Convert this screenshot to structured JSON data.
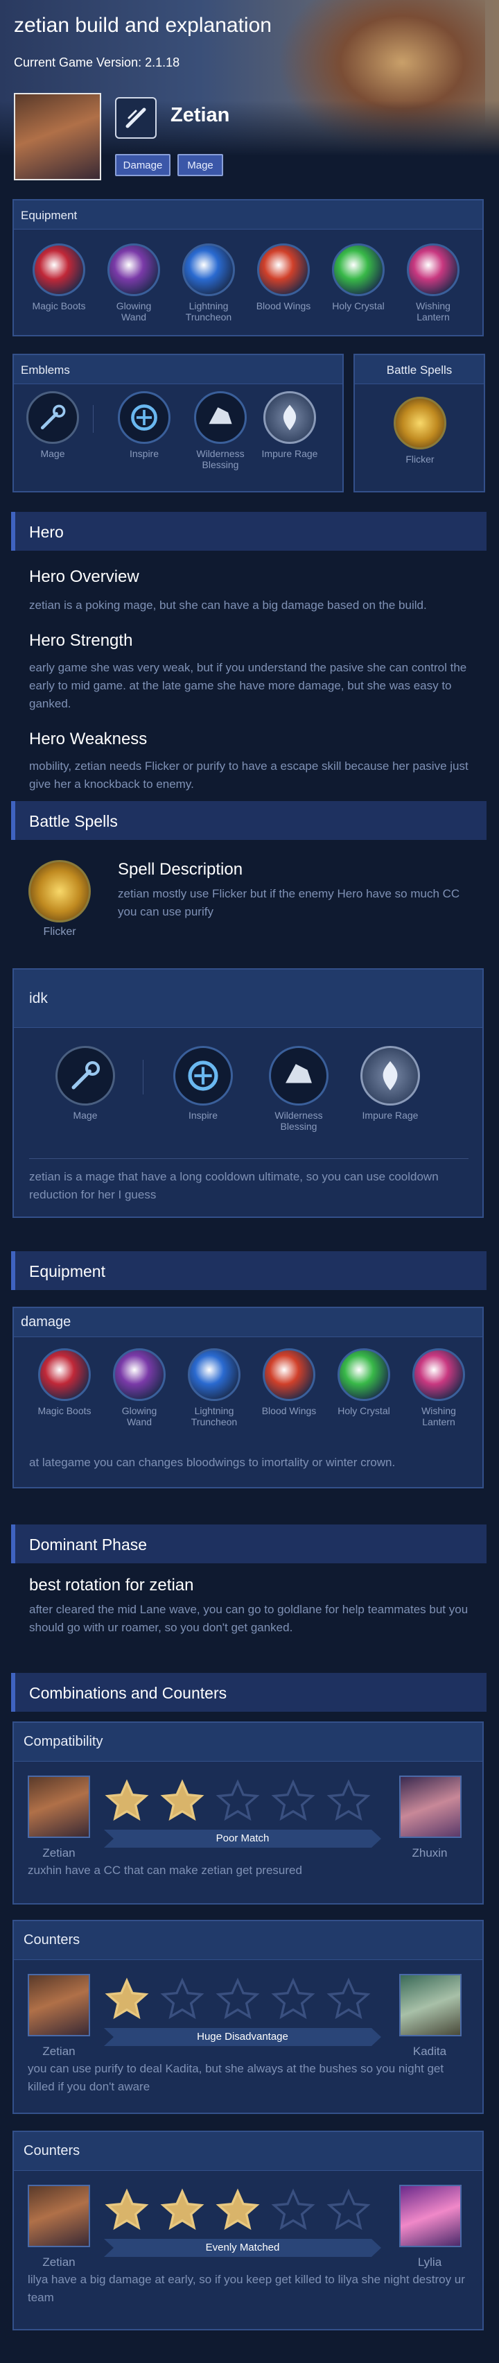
{
  "page": {
    "title": "zetian build and explanation",
    "version": "Current Game Version: 2.1.18"
  },
  "hero": {
    "name": "Zetian",
    "tags": [
      "Damage",
      "Mage"
    ]
  },
  "equipment_panel": {
    "title": "Equipment",
    "items": [
      {
        "label1": "Magic Boots",
        "label2": "",
        "color": "#c02838"
      },
      {
        "label1": "Glowing",
        "label2": "Wand",
        "color": "#7a3aa8"
      },
      {
        "label1": "Lightning",
        "label2": "Truncheon",
        "color": "#2a6ad0"
      },
      {
        "label1": "Blood Wings",
        "label2": "",
        "color": "#d0402a"
      },
      {
        "label1": "Holy Crystal",
        "label2": "",
        "color": "#38b848"
      },
      {
        "label1": "Wishing",
        "label2": "Lantern",
        "color": "#c83880"
      }
    ]
  },
  "emblems_panel": {
    "title": "Emblems",
    "items": [
      {
        "label1": "Mage",
        "label2": ""
      },
      {
        "label1": "Inspire",
        "label2": ""
      },
      {
        "label1": "Wilderness",
        "label2": "Blessing"
      },
      {
        "label1": "Impure Rage",
        "label2": ""
      }
    ]
  },
  "spells_panel": {
    "title": "Battle Spells",
    "spell": "Flicker"
  },
  "sections": {
    "hero": "Hero",
    "battle_spells": "Battle Spells",
    "equipment": "Equipment",
    "dominant": "Dominant Phase",
    "combos": "Combinations and Counters"
  },
  "overview": {
    "title": "Hero Overview",
    "text": "zetian is a poking mage, but she can have a big damage based on the build."
  },
  "strength": {
    "title": "Hero Strength",
    "text": "early game she was very weak, but if you understand the pasive she can control the early to mid game. at the late game she have more damage, but she was easy to ganked."
  },
  "weakness": {
    "title": "Hero Weakness",
    "text": "mobility, zetian needs Flicker or purify to have a escape skill because her pasive just give her a knockback to enemy."
  },
  "spell_desc": {
    "icon_label": "Flicker",
    "title": "Spell Description",
    "text": "zetian mostly use Flicker but if the enemy Hero have so much CC you can use purify"
  },
  "idk": {
    "title": "idk",
    "text": "zetian is a mage that have a long cooldown ultimate, so you can use cooldown reduction for her I guess"
  },
  "damage": {
    "title": "damage",
    "text": "at lategame you can changes bloodwings to imortality or winter crown."
  },
  "rotation": {
    "title": "best rotation for zetian",
    "text": "after cleared the mid Lane wave, you can go to goldlane for help teammates but you should go with ur roamer, so you don't get ganked."
  },
  "combos": [
    {
      "title": "Compatibility",
      "left": "Zetian",
      "right": "Zhuxin",
      "stars": 2,
      "rating": "Poor Match",
      "text": "zuxhin have a CC that can make zetian get presured"
    },
    {
      "title": "Counters",
      "left": "Zetian",
      "right": "Kadita",
      "stars": 1,
      "rating": "Huge Disadvantage",
      "text": "you can use purify to deal Kadita, but she always at the bushes so you night get killed if you don't aware"
    },
    {
      "title": "Counters",
      "left": "Zetian",
      "right": "Lylia",
      "stars": 3,
      "rating": "Evenly Matched",
      "text": "lilya have a big damage at early, so if you keep get killed to lilya she night destroy ur team"
    }
  ]
}
